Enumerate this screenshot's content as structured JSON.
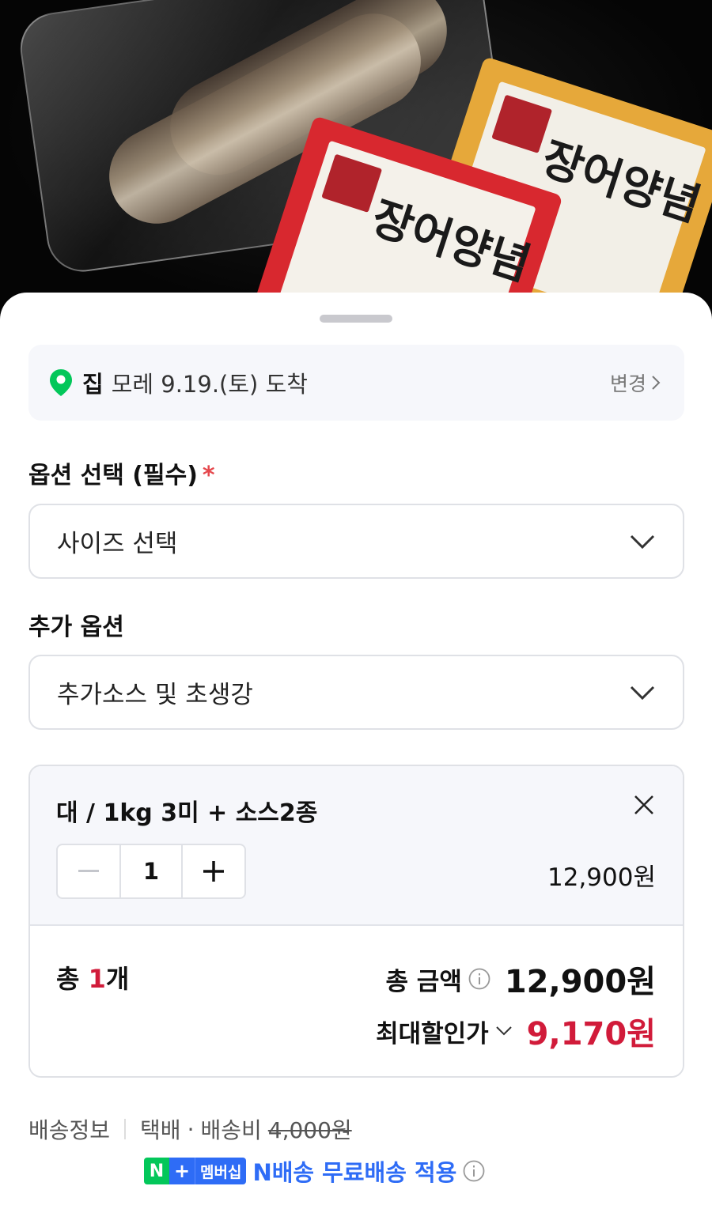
{
  "product_image": {
    "pack_text": "장어양념"
  },
  "delivery": {
    "place": "집",
    "date": "모레 9.19.(토) 도착",
    "change_label": "변경"
  },
  "option": {
    "label": "옵션 선택 (필수)",
    "required_mark": "*",
    "placeholder": "사이즈 선택"
  },
  "extra_option": {
    "label": "추가 옵션",
    "placeholder": "추가소스 및 초생강"
  },
  "cart_item": {
    "name": "대 / 1kg 3미 + 소스2종",
    "quantity": "1",
    "price": "12,900원"
  },
  "summary": {
    "count_prefix": "총 ",
    "count": "1",
    "count_suffix": "개",
    "total_label": "총 금액",
    "total_amount": "12,900원",
    "max_discount_label": "최대할인가",
    "max_discount_amount": "9,170원"
  },
  "shipping": {
    "label": "배송정보",
    "method": "택배",
    "fee_label": "배송비",
    "fee_original": "4,000원",
    "badge_n": "N",
    "badge_plus": "+",
    "badge_membership": "멤버십",
    "free_text": "N배송 무료배송 적용"
  },
  "colors": {
    "accent_red": "#d11b3a",
    "naver_green": "#03c75a",
    "membership_blue": "#2e6cf6"
  }
}
